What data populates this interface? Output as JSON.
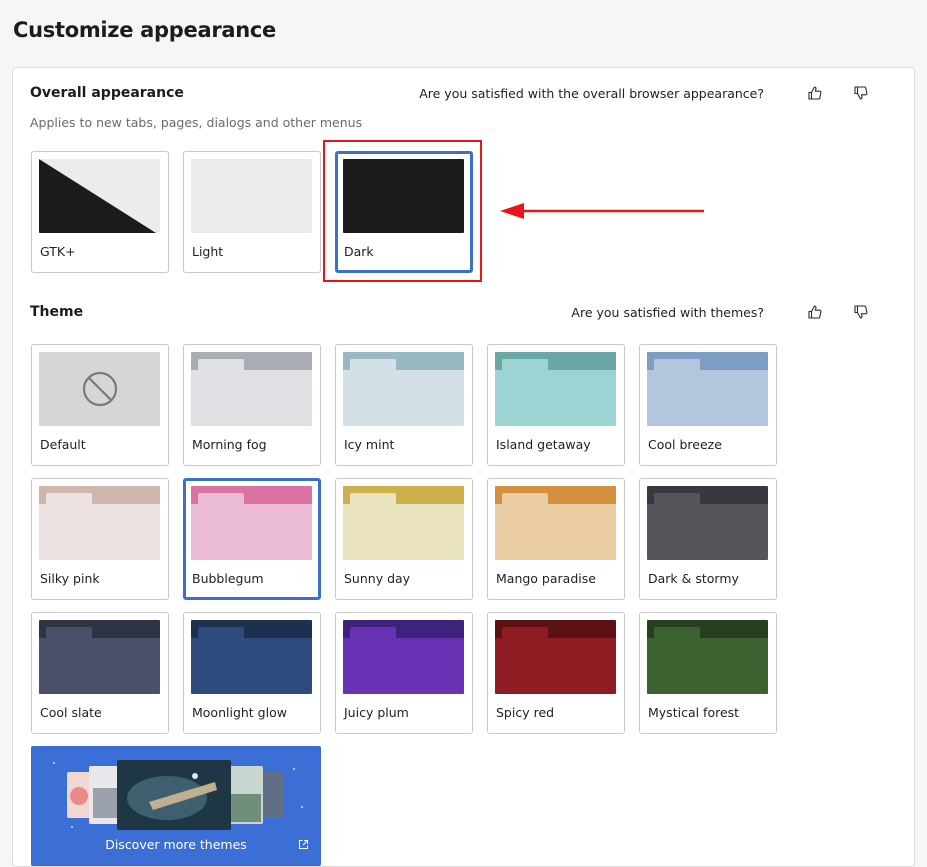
{
  "page": {
    "title": "Customize appearance"
  },
  "appearance": {
    "title": "Overall appearance",
    "subtitle": "Applies to new tabs, pages, dialogs and other menus",
    "feedback_question": "Are you satisfied with the overall browser appearance?",
    "options": [
      {
        "label": "GTK+",
        "selected": false
      },
      {
        "label": "Light",
        "selected": false
      },
      {
        "label": "Dark",
        "selected": true
      }
    ]
  },
  "theme": {
    "title": "Theme",
    "feedback_question": "Are you satisfied with themes?",
    "items": [
      {
        "label": "Default",
        "top": "#d6d6d6",
        "tab": "#d6d6d6",
        "body": "#d6d6d6",
        "selected": false
      },
      {
        "label": "Morning fog",
        "top": "#a9acb2",
        "tab": "#dfe0e4",
        "body": "#dfe0e4",
        "selected": false
      },
      {
        "label": "Icy mint",
        "top": "#98b9c4",
        "tab": "#d3e1e7",
        "body": "#d3e1e7",
        "selected": false
      },
      {
        "label": "Island getaway",
        "top": "#6aa8a6",
        "tab": "#9cd4d3",
        "body": "#9cd4d3",
        "selected": false
      },
      {
        "label": "Cool breeze",
        "top": "#7e9dc2",
        "tab": "#b3c6dd",
        "body": "#b3c6dd",
        "selected": false
      },
      {
        "label": "Silky pink",
        "top": "#cfb6ad",
        "tab": "#ece2e1",
        "body": "#ece2e1",
        "selected": false
      },
      {
        "label": "Bubblegum",
        "top": "#dc72a4",
        "tab": "#ebbcd3",
        "body": "#ebbcd3",
        "selected": true
      },
      {
        "label": "Sunny day",
        "top": "#cdb14a",
        "tab": "#eae3bf",
        "body": "#eae3bf",
        "selected": false
      },
      {
        "label": "Mango paradise",
        "top": "#d48f3f",
        "tab": "#e9cca1",
        "body": "#e9cca1",
        "selected": false
      },
      {
        "label": "Dark & stormy",
        "top": "#38393e",
        "tab": "#55565c",
        "body": "#55565c",
        "selected": false
      },
      {
        "label": "Cool slate",
        "top": "#2f3443",
        "tab": "#4a506a",
        "body": "#4a506a",
        "selected": false
      },
      {
        "label": "Moonlight glow",
        "top": "#1e3050",
        "tab": "#2f4a7c",
        "body": "#2f4a7c",
        "selected": false
      },
      {
        "label": "Juicy plum",
        "top": "#3f237a",
        "tab": "#6732b3",
        "body": "#6732b3",
        "selected": false
      },
      {
        "label": "Spicy red",
        "top": "#5c1115",
        "tab": "#8f1c22",
        "body": "#8f1c22",
        "selected": false
      },
      {
        "label": "Mystical forest",
        "top": "#263f20",
        "tab": "#3d6231",
        "body": "#3d6231",
        "selected": false
      }
    ],
    "discover_label": "Discover more themes"
  },
  "colors": {
    "selection": "#3d6fcc",
    "annotation": "#e8141c",
    "discover_bg": "#3b6fd6"
  },
  "icons": {
    "thumbs_up": "thumbs-up-icon",
    "thumbs_down": "thumbs-down-icon",
    "default_theme": "no-theme-icon",
    "external_link": "external-link-icon"
  }
}
